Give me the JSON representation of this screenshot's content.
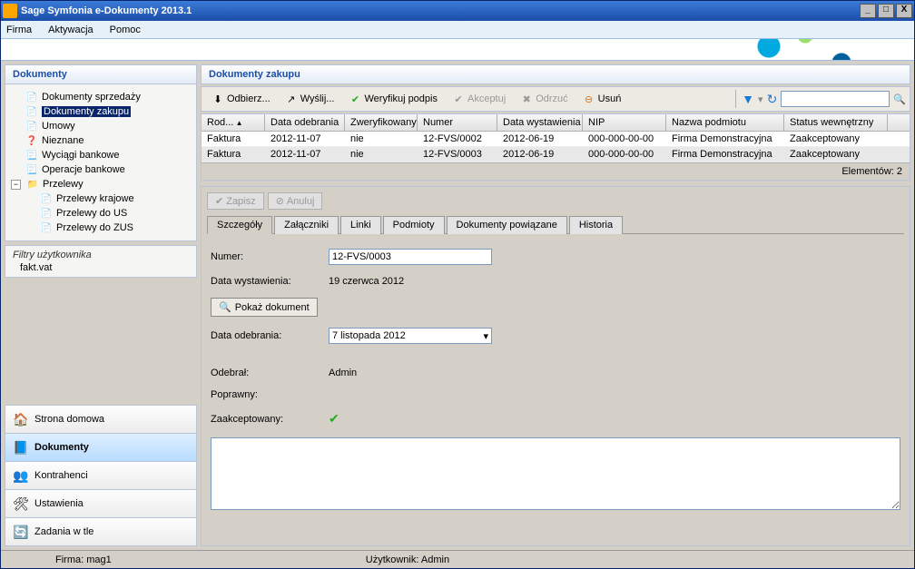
{
  "window": {
    "title": "Sage Symfonia e-Dokumenty 2013.1"
  },
  "menubar": [
    "Firma",
    "Aktywacja",
    "Pomoc"
  ],
  "leftPanel": {
    "title": "Dokumenty",
    "tree": [
      {
        "label": "Dokumenty sprzedaży",
        "indent": 1,
        "selected": false,
        "icon": "📄"
      },
      {
        "label": "Dokumenty zakupu",
        "indent": 1,
        "selected": true,
        "icon": "📄"
      },
      {
        "label": "Umowy",
        "indent": 1,
        "selected": false,
        "icon": "📄"
      },
      {
        "label": "Nieznane",
        "indent": 1,
        "selected": false,
        "icon": "❓"
      },
      {
        "label": "Wyciągi bankowe",
        "indent": 1,
        "selected": false,
        "icon": "📃"
      },
      {
        "label": "Operacje bankowe",
        "indent": 1,
        "selected": false,
        "icon": "📃"
      },
      {
        "label": "Przelewy",
        "indent": 0,
        "selected": false,
        "icon": "📁",
        "expander": "−"
      },
      {
        "label": "Przelewy krajowe",
        "indent": 2,
        "selected": false,
        "icon": "📄"
      },
      {
        "label": "Przelewy do US",
        "indent": 2,
        "selected": false,
        "icon": "📄"
      },
      {
        "label": "Przelewy do ZUS",
        "indent": 2,
        "selected": false,
        "icon": "📄"
      }
    ],
    "filters": {
      "title": "Filtry użytkownika",
      "items": [
        "fakt.vat"
      ]
    }
  },
  "leftNav": [
    {
      "label": "Strona domowa",
      "icon": "🏠",
      "active": false
    },
    {
      "label": "Dokumenty",
      "icon": "📘",
      "active": true
    },
    {
      "label": "Kontrahenci",
      "icon": "👥",
      "active": false
    },
    {
      "label": "Ustawienia",
      "icon": "🛠",
      "active": false
    },
    {
      "label": "Zadania w tle",
      "icon": "🔄",
      "active": false
    }
  ],
  "rightPanel": {
    "title": "Dokumenty zakupu",
    "toolbar": [
      {
        "label": "Odbierz...",
        "icon": "⬇",
        "enabled": true
      },
      {
        "label": "Wyślij...",
        "icon": "↗",
        "enabled": true
      },
      {
        "label": "Weryfikuj podpis",
        "icon": "✔",
        "enabled": true
      },
      {
        "label": "Akceptuj",
        "icon": "✔",
        "enabled": false
      },
      {
        "label": "Odrzuć",
        "icon": "✖",
        "enabled": false
      },
      {
        "label": "Usuń",
        "icon": "⊖",
        "enabled": true
      }
    ],
    "searchPlaceholder": "",
    "columns": [
      "Rod...",
      "Data odebrania",
      "Zweryfikowany",
      "Numer",
      "Data wystawienia",
      "NIP",
      "Nazwa podmiotu",
      "Status wewnętrzny"
    ],
    "rows": [
      {
        "cells": [
          "Faktura",
          "2012-11-07",
          "nie",
          "12-FVS/0002",
          "2012-06-19",
          "000-000-00-00",
          "Firma Demonstracyjna",
          "Zaakceptowany"
        ],
        "selected": false
      },
      {
        "cells": [
          "Faktura",
          "2012-11-07",
          "nie",
          "12-FVS/0003",
          "2012-06-19",
          "000-000-00-00",
          "Firma Demonstracyjna",
          "Zaakceptowany"
        ],
        "selected": true
      }
    ],
    "footer": "Elementów: 2"
  },
  "detail": {
    "actions": [
      {
        "label": "Zapisz",
        "icon": "✔",
        "enabled": false
      },
      {
        "label": "Anuluj",
        "icon": "⊘",
        "enabled": false
      }
    ],
    "tabs": [
      "Szczegóły",
      "Załączniki",
      "Linki",
      "Podmioty",
      "Dokumenty powiązane",
      "Historia"
    ],
    "activeTab": 0,
    "form": {
      "numer_label": "Numer:",
      "numer_value": "12-FVS/0003",
      "data_wyst_label": "Data wystawienia:",
      "data_wyst_value": "19 czerwca 2012",
      "pokaz_label": "Pokaż dokument",
      "data_odebr_label": "Data odebrania:",
      "data_odebr_value": "7   listopada   2012",
      "odebral_label": "Odebrał:",
      "odebral_value": "Admin",
      "poprawny_label": "Poprawny:",
      "zaakcept_label": "Zaakceptowany:"
    }
  },
  "statusbar": {
    "firma_label": "Firma: mag1",
    "user_label": "Użytkownik: Admin"
  }
}
